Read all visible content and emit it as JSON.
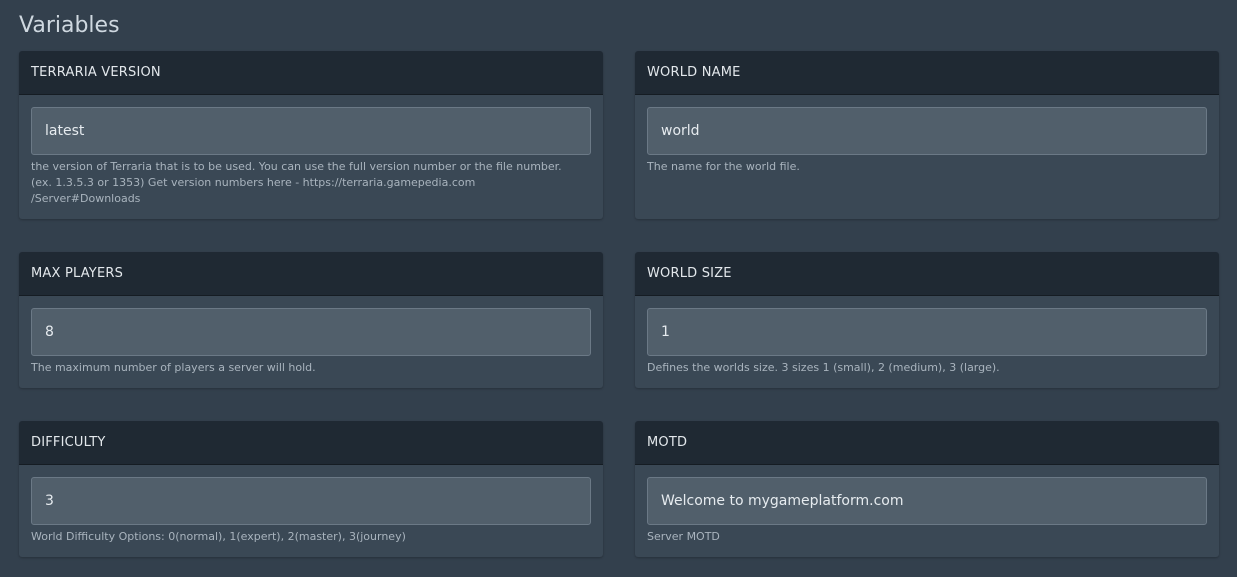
{
  "page": {
    "title": "Variables"
  },
  "variables": [
    {
      "label": "TERRARIA VERSION",
      "value": "latest",
      "desc_lines": [
        "the version of Terraria that is to be used.  You can use the full version number or the file number.",
        "(ex. 1.3.5.3 or 1353)  Get version numbers here - https://terraria.gamepedia.com",
        "/Server#Downloads"
      ]
    },
    {
      "label": "WORLD NAME",
      "value": "world",
      "desc_lines": [
        "The name for the world file."
      ]
    },
    {
      "label": "MAX PLAYERS",
      "value": "8",
      "desc_lines": [
        "The maximum number of players a server will hold."
      ]
    },
    {
      "label": "WORLD SIZE",
      "value": "1",
      "desc_lines": [
        "Defines the worlds size. 3 sizes 1 (small), 2 (medium), 3 (large)."
      ]
    },
    {
      "label": "DIFFICULTY",
      "value": "3",
      "desc_lines": [
        "World Difficulty  Options: 0(normal), 1(expert), 2(master), 3(journey)"
      ]
    },
    {
      "label": "MOTD",
      "value": "Welcome to mygameplatform.com",
      "desc_lines": [
        "Server MOTD"
      ]
    }
  ]
}
